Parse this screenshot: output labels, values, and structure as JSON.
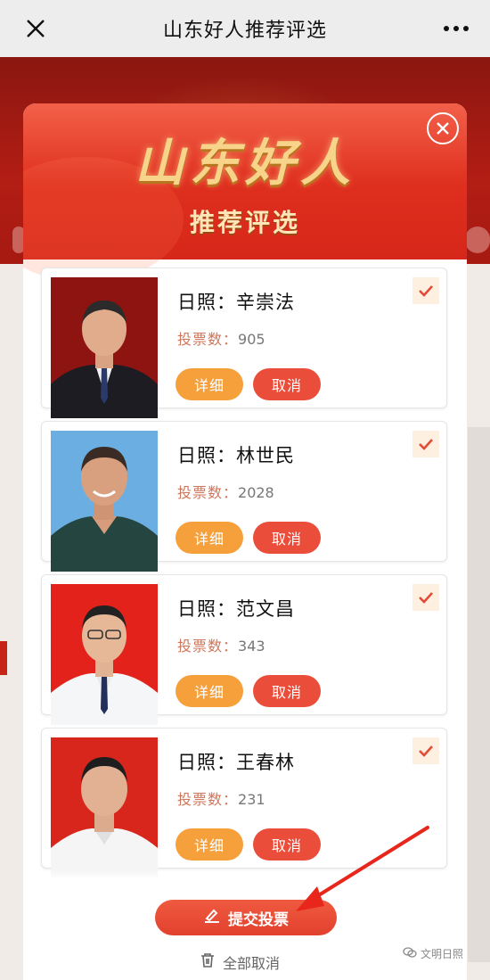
{
  "topbar": {
    "title": "山东好人推荐评选"
  },
  "header": {
    "brand_main": "山东好人",
    "brand_sub": "推荐评选"
  },
  "candidates": [
    {
      "name": "日照：辛崇法",
      "votes_label": "投票数：",
      "votes": "905",
      "detail_label": "详细",
      "cancel_label": "取消",
      "selected": true
    },
    {
      "name": "日照：林世民",
      "votes_label": "投票数：",
      "votes": "2028",
      "detail_label": "详细",
      "cancel_label": "取消",
      "selected": true
    },
    {
      "name": "日照：范文昌",
      "votes_label": "投票数：",
      "votes": "343",
      "detail_label": "详细",
      "cancel_label": "取消",
      "selected": true
    },
    {
      "name": "日照：王春林",
      "votes_label": "投票数：",
      "votes": "231",
      "detail_label": "详细",
      "cancel_label": "取消",
      "selected": true
    }
  ],
  "footer": {
    "submit_label": "提交投票",
    "cancel_all_label": "全部取消"
  },
  "watermark": {
    "text": "文明日照"
  },
  "colors": {
    "accent": "#ea4e3b",
    "detail": "#f5a03a",
    "header": "#de2e1e",
    "gold": "#f7d48a"
  },
  "icons": [
    "close-icon",
    "more-icon",
    "close-circle-icon",
    "check-icon",
    "vote-icon",
    "trash-icon"
  ]
}
